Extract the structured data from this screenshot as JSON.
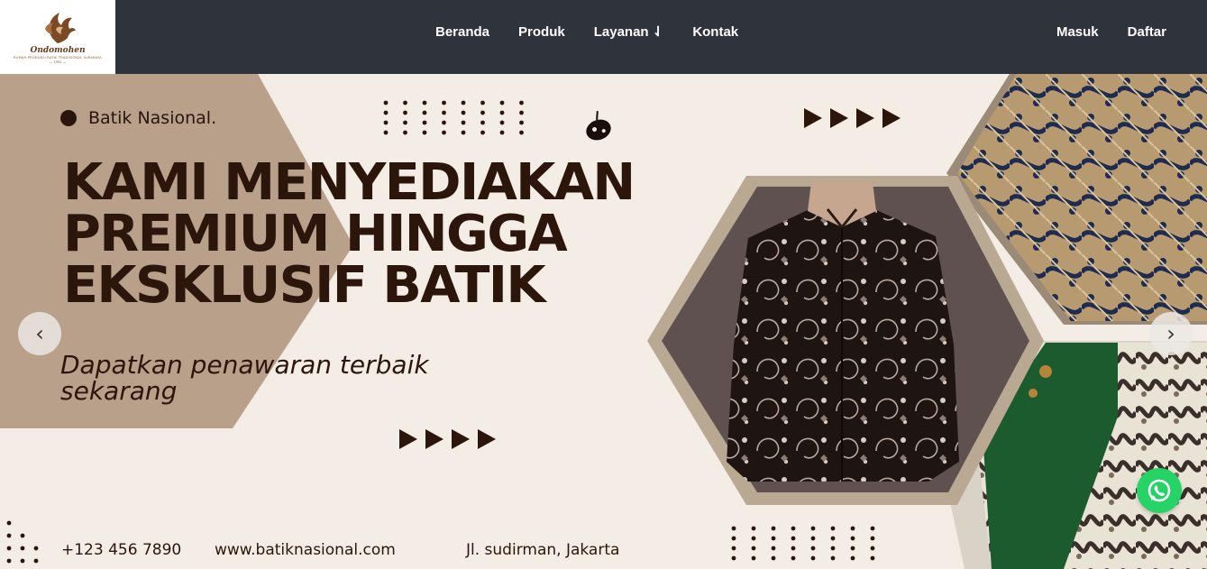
{
  "logo": {
    "name": "Ondomohen",
    "tagline": "RUMAH PRODUKSI BATIK TRADISIONAL SURABAYA",
    "year": "— 1952 —"
  },
  "nav": {
    "links": [
      {
        "label": "Beranda"
      },
      {
        "label": "Produk"
      },
      {
        "label": "Layanan ⇃"
      },
      {
        "label": "Kontak"
      }
    ],
    "auth": [
      {
        "label": "Masuk"
      },
      {
        "label": "Daftar"
      }
    ]
  },
  "hero": {
    "brand": "Batik Nasional.",
    "headline": [
      "KAMI MENYEDIAKAN",
      "PREMIUM HINGGA",
      "EKSKLUSIF BATIK"
    ],
    "subline": [
      "Dapatkan penawaran terbaik",
      "sekarang"
    ],
    "phone": "+123 456 7890",
    "website": "www.batiknasional.com",
    "address": "Jl. sudirman, Jakarta"
  },
  "carousel": {
    "prev_icon": "‹",
    "next_icon": "›"
  },
  "colors": {
    "navbar": "#2f333c",
    "hero_bg": "#f3ede5",
    "accent_dark": "#2c160c",
    "hexagon": "#5c4e4c",
    "whatsapp": "#25d366"
  },
  "icons": {
    "whatsapp": "whatsapp-icon",
    "prev": "chevron-left-icon",
    "next": "chevron-right-icon"
  }
}
